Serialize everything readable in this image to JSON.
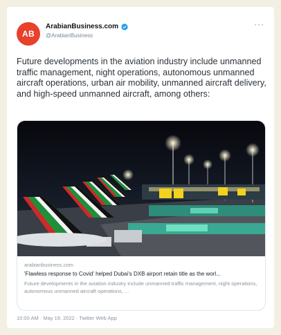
{
  "tweet": {
    "avatar_text": "AB",
    "author_name": "ArabianBusiness.com",
    "handle": "@ArabianBusiness",
    "body": "Future developments in the aviation industry include unmanned traffic management, night operations, autonomous unmanned aircraft operations, urban air mobility, unmanned aircraft delivery, and high-speed unmanned aircraft, among others:",
    "timestamp": "10:00 AM · May 19, 2022 · Twitter Web App"
  },
  "link_card": {
    "domain": "arabianbusiness.com",
    "title": "'Flawless response to Covid' helped Dubai's DXB airport retain title as the worl...",
    "description": "Future developments in the aviation industry include unmanned traffic management, night operations, autonomous unmanned aircraft operations, ..."
  },
  "colors": {
    "avatar": "#e8412c",
    "verified": "#1d9bf0",
    "background": "#f4efe3"
  },
  "icons": {
    "more": "more-icon",
    "verified": "verified-badge-icon"
  }
}
